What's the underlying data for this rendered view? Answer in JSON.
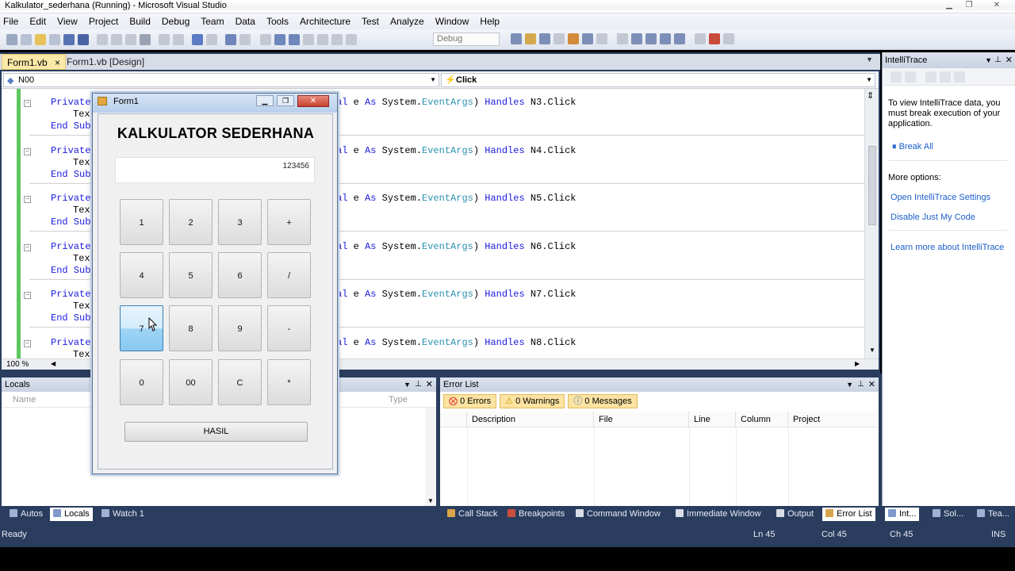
{
  "window": {
    "title": "Kalkulator_sederhana (Running) - Microsoft Visual Studio"
  },
  "menu": [
    "File",
    "Edit",
    "View",
    "Project",
    "Build",
    "Debug",
    "Team",
    "Data",
    "Tools",
    "Architecture",
    "Test",
    "Analyze",
    "Window",
    "Help"
  ],
  "toolbar": {
    "config": "Debug"
  },
  "doc_tabs": [
    {
      "label": "Form1.vb",
      "close": "×"
    },
    {
      "label": "Form1.vb [Design]"
    }
  ],
  "nav": {
    "object": "N00",
    "event": "Click"
  },
  "code": {
    "lines": [
      {
        "prefix": "Private",
        "handles": "N3.Click"
      },
      {
        "prefix": "Private",
        "handles": "N4.Click"
      },
      {
        "prefix": "Private",
        "handles": "N5.Click"
      },
      {
        "prefix": "Private",
        "handles": "N6.Click"
      },
      {
        "prefix": "Private",
        "handles": "N7.Click"
      },
      {
        "prefix": "Private",
        "handles": "N8.Click"
      }
    ],
    "text_stub": "Text",
    "end_sub": "End Sub",
    "sig_al": "al",
    "sig_e": " e ",
    "sig_as": "As",
    "sig_sys": " System.",
    "sig_type": "EventArgs",
    "sig_close": ") ",
    "sig_handles": "Handles",
    "zoom": "100 %"
  },
  "intellitrace": {
    "title": "IntelliTrace",
    "intro": "To view IntelliTrace data, you must break execution of your application.",
    "break_all": "Break All",
    "more_options": "More options:",
    "links": [
      "Open IntelliTrace Settings",
      "Disable Just My Code"
    ],
    "learn_more": "Learn more about IntelliTrace"
  },
  "locals": {
    "title": "Locals",
    "columns": [
      "Name",
      "Type"
    ]
  },
  "error_list": {
    "title": "Error List",
    "filters": [
      "0 Errors",
      "0 Warnings",
      "0 Messages"
    ],
    "columns": [
      "Description",
      "File",
      "Line",
      "Column",
      "Project"
    ]
  },
  "bottom_tabs_left": [
    "Autos",
    "Locals",
    "Watch 1"
  ],
  "bottom_tabs_right": [
    "Call Stack",
    "Breakpoints",
    "Command Window",
    "Immediate Window",
    "Output",
    "Error List"
  ],
  "side_tabs": [
    "Int...",
    "Sol...",
    "Tea..."
  ],
  "status": {
    "text": "Ready",
    "ln": "Ln 45",
    "col": "Col 45",
    "ch": "Ch 45",
    "mode": "INS"
  },
  "form": {
    "title": "Form1",
    "heading": "KALKULATOR SEDERHANA",
    "display": "123456",
    "keys": [
      [
        "1",
        "2",
        "3",
        "+"
      ],
      [
        "4",
        "5",
        "6",
        "/"
      ],
      [
        "7",
        "8",
        "9",
        "-"
      ],
      [
        "0",
        "00",
        "C",
        "*"
      ]
    ],
    "equals": "HASIL"
  },
  "colors": {
    "ide_frame": "#2a3d5e",
    "code_keyword": "#1a1ae0",
    "code_type": "#2b91af",
    "active_tab": "#fbe9a8"
  }
}
